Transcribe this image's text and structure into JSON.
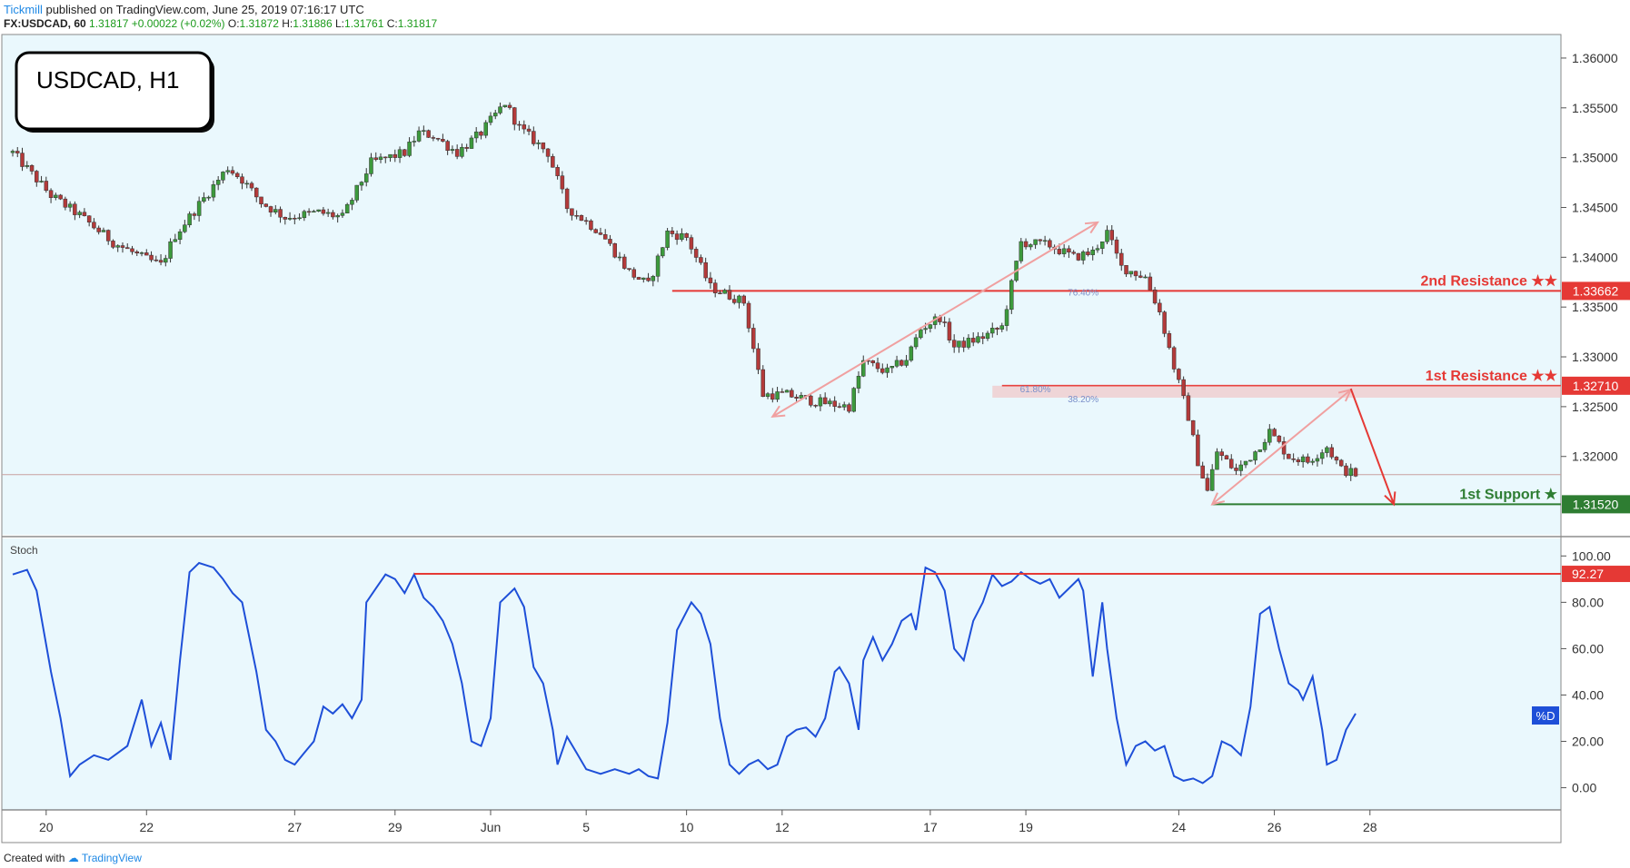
{
  "header": {
    "author": "Tickmill",
    "published_text": "published on TradingView.com, June 25, 2019 07:16:17 UTC",
    "symbol": "FX:USDCAD, 60",
    "last": "1.31817",
    "change": "+0.00022 (+0.02%)",
    "o_label": "O:",
    "o": "1.31872",
    "h_label": "H:",
    "h": "1.31886",
    "l_label": "L:",
    "l": "1.31761",
    "c_label": "C:",
    "c": "1.31817"
  },
  "title_box": "USDCAD, H1",
  "footer": {
    "created_with": "Created with",
    "brand": "TradingView"
  },
  "colors": {
    "bg": "#eaf8fd",
    "up": "#3c9a3c",
    "down": "#b33a3a",
    "resistance": "#e53935",
    "support": "#2e7d32",
    "stoch": "#1e4fd8",
    "arrow": "#f0a0a0"
  },
  "chart_data": [
    {
      "type": "candlestick",
      "title": "USDCAD, H1",
      "ylim": [
        1.3125,
        1.362
      ],
      "x_ticks": [
        "20",
        "22",
        "27",
        "29",
        "Jun",
        "5",
        "10",
        "12",
        "17",
        "19",
        "24",
        "26",
        "28"
      ],
      "y_ticks": [
        "1.36000",
        "1.35500",
        "1.35000",
        "1.34500",
        "1.34000",
        "1.33500",
        "1.33000",
        "1.32500",
        "1.32000"
      ],
      "price_path": [
        {
          "x": 0,
          "y": 1.3505
        },
        {
          "x": 8,
          "y": 1.3462
        },
        {
          "x": 14,
          "y": 1.3442
        },
        {
          "x": 21,
          "y": 1.3415
        },
        {
          "x": 27,
          "y": 1.34
        },
        {
          "x": 31,
          "y": 1.3392
        },
        {
          "x": 34,
          "y": 1.3422
        },
        {
          "x": 45,
          "y": 1.349
        },
        {
          "x": 48,
          "y": 1.3478
        },
        {
          "x": 52,
          "y": 1.3455
        },
        {
          "x": 57,
          "y": 1.344
        },
        {
          "x": 64,
          "y": 1.3445
        },
        {
          "x": 69,
          "y": 1.344
        },
        {
          "x": 75,
          "y": 1.3495
        },
        {
          "x": 82,
          "y": 1.3505
        },
        {
          "x": 85,
          "y": 1.3525
        },
        {
          "x": 88,
          "y": 1.3522
        },
        {
          "x": 93,
          "y": 1.3505
        },
        {
          "x": 98,
          "y": 1.3525
        },
        {
          "x": 103,
          "y": 1.3555
        },
        {
          "x": 106,
          "y": 1.353
        },
        {
          "x": 112,
          "y": 1.3505
        },
        {
          "x": 116,
          "y": 1.345
        },
        {
          "x": 123,
          "y": 1.3425
        },
        {
          "x": 129,
          "y": 1.3385
        },
        {
          "x": 133,
          "y": 1.3372
        },
        {
          "x": 137,
          "y": 1.3425
        },
        {
          "x": 141,
          "y": 1.342
        },
        {
          "x": 146,
          "y": 1.337
        },
        {
          "x": 153,
          "y": 1.3355
        },
        {
          "x": 157,
          "y": 1.3262
        },
        {
          "x": 162,
          "y": 1.3262
        },
        {
          "x": 168,
          "y": 1.3255
        },
        {
          "x": 175,
          "y": 1.325
        },
        {
          "x": 178,
          "y": 1.3295
        },
        {
          "x": 183,
          "y": 1.3285
        },
        {
          "x": 187,
          "y": 1.3298
        },
        {
          "x": 190,
          "y": 1.3328
        },
        {
          "x": 194,
          "y": 1.334
        },
        {
          "x": 197,
          "y": 1.331
        },
        {
          "x": 203,
          "y": 1.332
        },
        {
          "x": 207,
          "y": 1.333
        },
        {
          "x": 211,
          "y": 1.3415
        },
        {
          "x": 217,
          "y": 1.3412
        },
        {
          "x": 222,
          "y": 1.34
        },
        {
          "x": 226,
          "y": 1.3405
        },
        {
          "x": 229,
          "y": 1.3425
        },
        {
          "x": 232,
          "y": 1.339
        },
        {
          "x": 237,
          "y": 1.338
        },
        {
          "x": 240,
          "y": 1.3345
        },
        {
          "x": 243,
          "y": 1.329
        },
        {
          "x": 246,
          "y": 1.324
        },
        {
          "x": 248,
          "y": 1.3195
        },
        {
          "x": 250,
          "y": 1.3165
        },
        {
          "x": 252,
          "y": 1.3205
        },
        {
          "x": 256,
          "y": 1.3185
        },
        {
          "x": 260,
          "y": 1.3205
        },
        {
          "x": 263,
          "y": 1.3225
        },
        {
          "x": 267,
          "y": 1.32
        },
        {
          "x": 271,
          "y": 1.3195
        },
        {
          "x": 275,
          "y": 1.321
        },
        {
          "x": 278,
          "y": 1.3187
        },
        {
          "x": 281,
          "y": 1.3182
        }
      ],
      "bars_total": 282,
      "levels": [
        {
          "name": "2nd Resistance ★★",
          "value": 1.33662,
          "label": "1.33662",
          "color": "#e53935"
        },
        {
          "name": "1st Resistance ★★",
          "value": 1.3271,
          "label": "1.32710",
          "color": "#e53935"
        },
        {
          "name": "1st Support ★",
          "value": 1.3152,
          "label": "1.31520",
          "color": "#2e7d32"
        }
      ],
      "annotations": [
        {
          "text": "76.40%",
          "x": 224,
          "y": 1.3365
        },
        {
          "text": "61.80%",
          "x": 214,
          "y": 1.3268
        },
        {
          "text": "38.20%",
          "x": 224,
          "y": 1.3258
        }
      ],
      "arrows": [
        {
          "from": {
            "x": 159,
            "y": 1.324
          },
          "to": {
            "x": 227,
            "y": 1.3435
          }
        },
        {
          "from": {
            "x": 251,
            "y": 1.3152
          },
          "to": {
            "x": 280,
            "y": 1.3267
          }
        }
      ],
      "forecast_arrow": {
        "from": {
          "x": 280,
          "y": 1.3268
        },
        "to": {
          "x": 289,
          "y": 1.3152
        }
      },
      "current_price": 1.31817
    },
    {
      "type": "line",
      "title": "Stoch",
      "ylim": [
        -8,
        106
      ],
      "y_ticks": [
        "100.00",
        "80.00",
        "60.00",
        "40.00",
        "20.00",
        "0.00"
      ],
      "series": [
        {
          "name": "%D",
          "points": [
            {
              "x": 0,
              "y": 92
            },
            {
              "x": 3,
              "y": 94
            },
            {
              "x": 5,
              "y": 85
            },
            {
              "x": 8,
              "y": 50
            },
            {
              "x": 10,
              "y": 30
            },
            {
              "x": 12,
              "y": 5
            },
            {
              "x": 14,
              "y": 10
            },
            {
              "x": 17,
              "y": 14
            },
            {
              "x": 20,
              "y": 12
            },
            {
              "x": 24,
              "y": 18
            },
            {
              "x": 27,
              "y": 38
            },
            {
              "x": 29,
              "y": 18
            },
            {
              "x": 31,
              "y": 28
            },
            {
              "x": 33,
              "y": 12
            },
            {
              "x": 35,
              "y": 55
            },
            {
              "x": 37,
              "y": 93
            },
            {
              "x": 39,
              "y": 97
            },
            {
              "x": 42,
              "y": 95
            },
            {
              "x": 44,
              "y": 90
            },
            {
              "x": 46,
              "y": 84
            },
            {
              "x": 48,
              "y": 80
            },
            {
              "x": 51,
              "y": 50
            },
            {
              "x": 53,
              "y": 25
            },
            {
              "x": 55,
              "y": 20
            },
            {
              "x": 57,
              "y": 12
            },
            {
              "x": 59,
              "y": 10
            },
            {
              "x": 61,
              "y": 15
            },
            {
              "x": 63,
              "y": 20
            },
            {
              "x": 65,
              "y": 35
            },
            {
              "x": 67,
              "y": 32
            },
            {
              "x": 69,
              "y": 36
            },
            {
              "x": 71,
              "y": 30
            },
            {
              "x": 73,
              "y": 38
            },
            {
              "x": 74,
              "y": 80
            },
            {
              "x": 76,
              "y": 86
            },
            {
              "x": 78,
              "y": 92
            },
            {
              "x": 80,
              "y": 90
            },
            {
              "x": 82,
              "y": 84
            },
            {
              "x": 84,
              "y": 92
            },
            {
              "x": 86,
              "y": 82
            },
            {
              "x": 88,
              "y": 78
            },
            {
              "x": 90,
              "y": 72
            },
            {
              "x": 92,
              "y": 62
            },
            {
              "x": 94,
              "y": 45
            },
            {
              "x": 96,
              "y": 20
            },
            {
              "x": 98,
              "y": 18
            },
            {
              "x": 100,
              "y": 30
            },
            {
              "x": 102,
              "y": 80
            },
            {
              "x": 105,
              "y": 86
            },
            {
              "x": 107,
              "y": 78
            },
            {
              "x": 109,
              "y": 52
            },
            {
              "x": 111,
              "y": 45
            },
            {
              "x": 113,
              "y": 25
            },
            {
              "x": 114,
              "y": 10
            },
            {
              "x": 116,
              "y": 22
            },
            {
              "x": 118,
              "y": 15
            },
            {
              "x": 120,
              "y": 8
            },
            {
              "x": 123,
              "y": 6
            },
            {
              "x": 126,
              "y": 8
            },
            {
              "x": 129,
              "y": 6
            },
            {
              "x": 131,
              "y": 8
            },
            {
              "x": 133,
              "y": 5
            },
            {
              "x": 135,
              "y": 4
            },
            {
              "x": 137,
              "y": 28
            },
            {
              "x": 139,
              "y": 68
            },
            {
              "x": 142,
              "y": 80
            },
            {
              "x": 144,
              "y": 75
            },
            {
              "x": 146,
              "y": 62
            },
            {
              "x": 148,
              "y": 30
            },
            {
              "x": 150,
              "y": 10
            },
            {
              "x": 152,
              "y": 6
            },
            {
              "x": 154,
              "y": 10
            },
            {
              "x": 156,
              "y": 12
            },
            {
              "x": 158,
              "y": 8
            },
            {
              "x": 160,
              "y": 10
            },
            {
              "x": 162,
              "y": 22
            },
            {
              "x": 164,
              "y": 25
            },
            {
              "x": 166,
              "y": 26
            },
            {
              "x": 168,
              "y": 22
            },
            {
              "x": 170,
              "y": 30
            },
            {
              "x": 172,
              "y": 50
            },
            {
              "x": 173,
              "y": 52
            },
            {
              "x": 175,
              "y": 45
            },
            {
              "x": 177,
              "y": 25
            },
            {
              "x": 178,
              "y": 55
            },
            {
              "x": 180,
              "y": 65
            },
            {
              "x": 182,
              "y": 55
            },
            {
              "x": 184,
              "y": 62
            },
            {
              "x": 186,
              "y": 72
            },
            {
              "x": 188,
              "y": 75
            },
            {
              "x": 189,
              "y": 68
            },
            {
              "x": 191,
              "y": 95
            },
            {
              "x": 193,
              "y": 93
            },
            {
              "x": 195,
              "y": 85
            },
            {
              "x": 197,
              "y": 60
            },
            {
              "x": 199,
              "y": 55
            },
            {
              "x": 201,
              "y": 72
            },
            {
              "x": 203,
              "y": 80
            },
            {
              "x": 205,
              "y": 92
            },
            {
              "x": 207,
              "y": 87
            },
            {
              "x": 209,
              "y": 89
            },
            {
              "x": 211,
              "y": 93
            },
            {
              "x": 213,
              "y": 90
            },
            {
              "x": 215,
              "y": 88
            },
            {
              "x": 217,
              "y": 90
            },
            {
              "x": 219,
              "y": 82
            },
            {
              "x": 221,
              "y": 86
            },
            {
              "x": 223,
              "y": 90
            },
            {
              "x": 224,
              "y": 85
            },
            {
              "x": 226,
              "y": 48
            },
            {
              "x": 228,
              "y": 80
            },
            {
              "x": 229,
              "y": 60
            },
            {
              "x": 231,
              "y": 30
            },
            {
              "x": 233,
              "y": 10
            },
            {
              "x": 235,
              "y": 18
            },
            {
              "x": 237,
              "y": 20
            },
            {
              "x": 239,
              "y": 16
            },
            {
              "x": 241,
              "y": 18
            },
            {
              "x": 243,
              "y": 5
            },
            {
              "x": 245,
              "y": 3
            },
            {
              "x": 247,
              "y": 4
            },
            {
              "x": 249,
              "y": 2
            },
            {
              "x": 251,
              "y": 5
            },
            {
              "x": 253,
              "y": 20
            },
            {
              "x": 255,
              "y": 18
            },
            {
              "x": 257,
              "y": 14
            },
            {
              "x": 259,
              "y": 35
            },
            {
              "x": 261,
              "y": 75
            },
            {
              "x": 263,
              "y": 78
            },
            {
              "x": 265,
              "y": 60
            },
            {
              "x": 267,
              "y": 45
            },
            {
              "x": 269,
              "y": 42
            },
            {
              "x": 270,
              "y": 38
            },
            {
              "x": 272,
              "y": 48
            },
            {
              "x": 274,
              "y": 25
            },
            {
              "x": 275,
              "y": 10
            },
            {
              "x": 277,
              "y": 12
            },
            {
              "x": 279,
              "y": 25
            },
            {
              "x": 281,
              "y": 32
            }
          ]
        }
      ],
      "level": {
        "value": 92.27,
        "label": "92.27",
        "color": "#e53935"
      },
      "series_tag": "%D"
    }
  ]
}
